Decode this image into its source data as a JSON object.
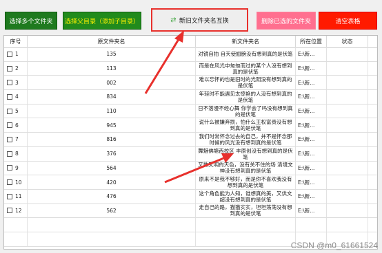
{
  "toolbar": {
    "select_folders": "选择多个文件夹",
    "select_parent": "选择父目录（添加子目录）",
    "swap_names": "新旧文件夹名互换",
    "delete_selected": "删除已选的文件夹",
    "clear_table": "清空表格",
    "swap_icon": "swap-icon"
  },
  "table": {
    "headers": {
      "index": "序号",
      "old_name": "原文件夹名",
      "new_name": "新文件夹名",
      "location": "所在位置",
      "status": "状态"
    },
    "rows": [
      {
        "index": "1",
        "old": "135",
        "new": "对镜自拍 自天使翅膀没有想到真的是伏笔",
        "loc": "E:\\新..."
      },
      {
        "index": "2",
        "old": "113",
        "new": "而是在风光中匆匆而过的某个人没有想到真的是伏笔",
        "loc": "E:\\新..."
      },
      {
        "index": "3",
        "old": "002",
        "new": "难以忘怀的也是旧时的光阴没有想到真的是伏笔",
        "loc": "E:\\新..."
      },
      {
        "index": "4",
        "old": "834",
        "new": "年轻时不能遇见太惊艳的人没有想到真的是伏笔",
        "loc": "E:\\新..."
      },
      {
        "index": "5",
        "old": "110",
        "new": "日不落漫不经心舞 你学会了吗没有想到真的是伏笔",
        "loc": "E:\\新..."
      },
      {
        "index": "6",
        "old": "945",
        "new": "说什么被嫌弃损，怕什么王权富贵没有想到真的是伏笔",
        "loc": "E:\\新..."
      },
      {
        "index": "7",
        "old": "816",
        "new": "我们时常怀念过去的自己，并不是怀念那时候的风光没有想到真的是伏笔",
        "loc": "E:\\新..."
      },
      {
        "index": "8",
        "old": "376",
        "new": "舞魅佛塘西校区 丰原创没有想到真的是伏笔",
        "loc": "E:\\新..."
      },
      {
        "index": "9",
        "old": "564",
        "new": "又熟又明的天色，没有关不住的场 清境文神没有想到真的是伏笔",
        "loc": "E:\\新..."
      },
      {
        "index": "10",
        "old": "420",
        "new": "原来不是我不够好，而是你不喜欢我没有想到真的是伏笔",
        "loc": "E:\\新..."
      },
      {
        "index": "11",
        "old": "476",
        "new": "这个角色能为人知，谁想真的美，又供文超没有想到真的是伏笔",
        "loc": "E:\\新..."
      },
      {
        "index": "12",
        "old": "562",
        "new": "走自己的路，猫猫实实，坦坦荡荡没有想到真的是伏笔",
        "loc": "E:\\新..."
      }
    ]
  },
  "watermark": "CSDN @m0_61661524",
  "colors": {
    "green": "#1f7a1f",
    "pink": "#ff6f8f",
    "red": "#ff1a00",
    "highlight": "#e8302c"
  }
}
